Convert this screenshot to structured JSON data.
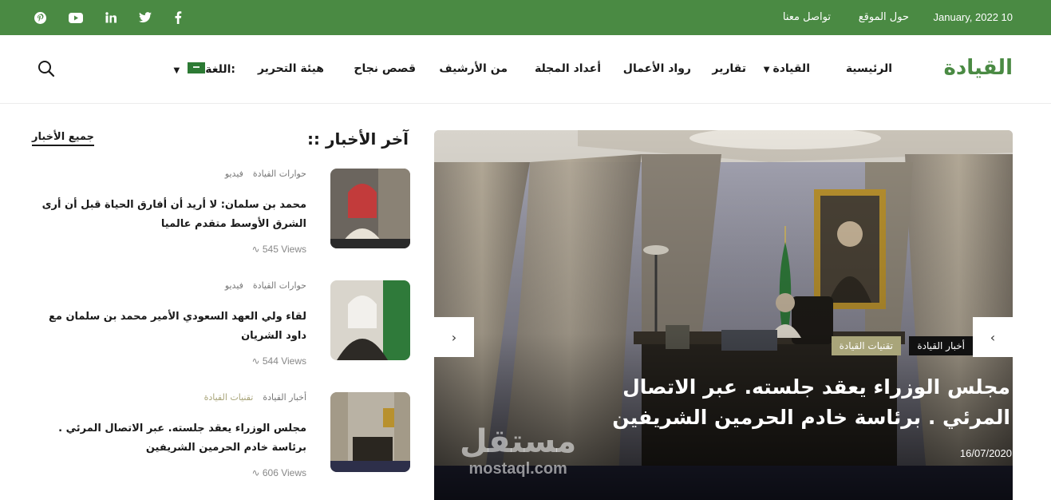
{
  "topbar": {
    "date": "January, 2022 10",
    "links": [
      "حول الموقع",
      "تواصل معنا"
    ],
    "social_icons": [
      "facebook-icon",
      "twitter-icon",
      "linkedin-icon",
      "youtube-icon",
      "pinterest-icon"
    ],
    "background": "#4a8a43"
  },
  "nav": {
    "logo": "القيادة",
    "items": [
      "الرئيسية",
      "القيادة",
      "تقارير",
      "رواد الأعمال",
      "أعداد المجلة",
      "من الأرشيف",
      "قصص نجاح",
      "هيئة التحرير",
      "اللغة:"
    ],
    "search_icon": "search-icon"
  },
  "hero": {
    "tags": [
      "أخبار القيادة",
      "تقنيات القيادة"
    ],
    "title": "مجلس الوزراء يعقد جلسته. عبر الاتصال المرئي . برئاسة خادم الحرمين الشريفين",
    "date": "16/07/2020",
    "watermark_ar": "مستقل",
    "watermark_en": "mostaql.com",
    "prev_icon": "chevron-left-icon",
    "next_icon": "chevron-right-icon"
  },
  "news": {
    "heading": ":: آخر الأخبار",
    "all_link": "جميع الأخبار",
    "items": [
      {
        "cats": [
          "حوارات القيادة",
          "فيديو"
        ],
        "title": "محمد بن سلمان: لا أريد أن أفارق الحياة قبل أن أرى الشرق الأوسط متقدم عالميا",
        "views": "545 Views"
      },
      {
        "cats": [
          "حوارات القيادة",
          "فيديو"
        ],
        "title": "لقاء ولي العهد السعودي الأمير محمد بن سلمان مع داود الشريان",
        "views": "544 Views"
      },
      {
        "cats": [
          "أخبار القيادة",
          "تقنيات القيادة"
        ],
        "title": "مجلس الوزراء يعقد جلسته. عبر الاتصال المرئي . برئاسة خادم الحرمين الشريفين",
        "views": "606 Views"
      }
    ]
  },
  "colors": {
    "accent": "#4a8a43",
    "tag_gold": "#a9a57a",
    "tag_dark": "#111111"
  }
}
